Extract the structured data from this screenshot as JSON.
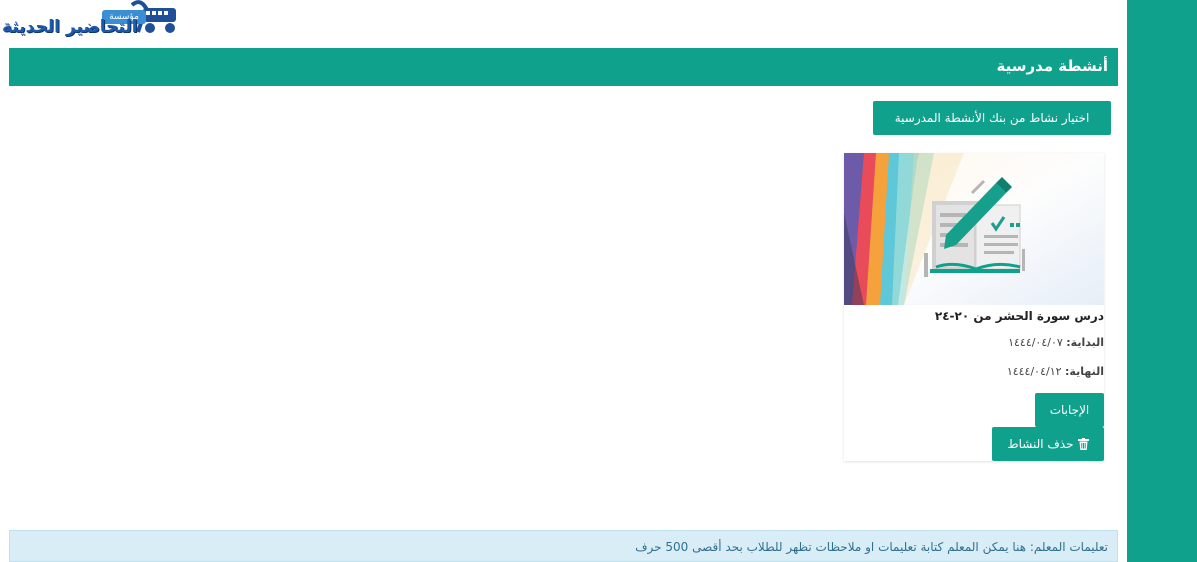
{
  "logo": {
    "name": "التحاضير الحديثة",
    "badge": "مؤسسة"
  },
  "header": {
    "title": "أنشطة مدرسية"
  },
  "bank_button": {
    "label": "اختيار نشاط من بنك الأنشطة المدرسية"
  },
  "activity_card": {
    "title": "درس سورة الحشر من ٢٠-٢٤",
    "start_label": "البداية:",
    "start_date": "١٤٤٤/٠٤/٠٧",
    "end_label": "النهاية:",
    "end_date": "١٤٤٤/٠٤/١٢",
    "answers_label": "الإجابات",
    "delete_label": "حذف النشاط",
    "delete_icon": "trash-icon",
    "image_icon": "document-edit-icon"
  },
  "instructions": {
    "text": "تعليمات المعلم: هنا يمكن المعلم كتابة تعليمات او ملاحظات تظهر للطلاب بحد أقصى 500 حرف"
  },
  "colors": {
    "accent": "#0fa18c",
    "info_bg": "#d9edf7",
    "info_text": "#31708f"
  }
}
